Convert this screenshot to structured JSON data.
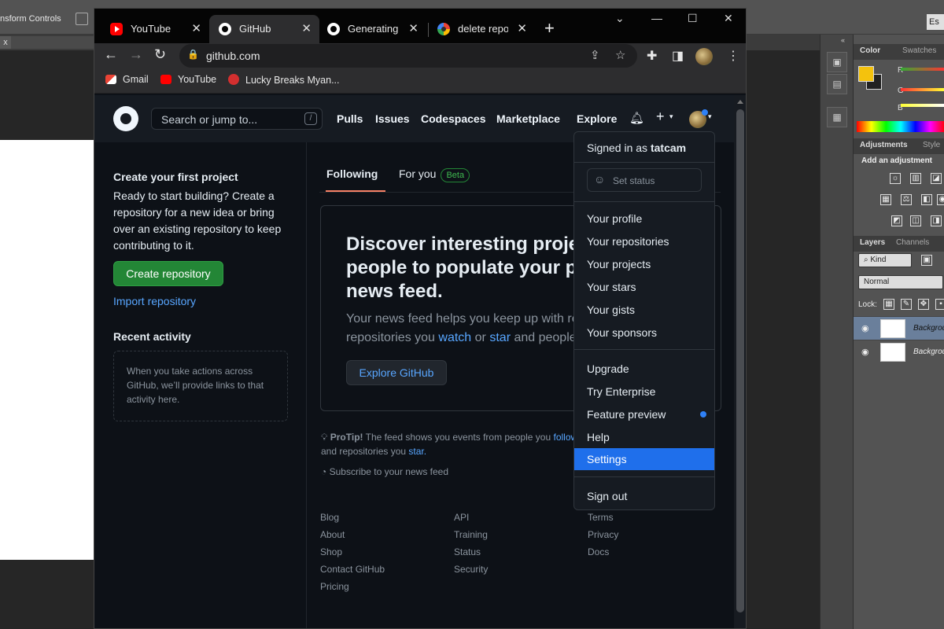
{
  "photoshop": {
    "options_label": "nsform Controls",
    "tab_close": "x",
    "esc_label": "Es",
    "panels": {
      "color_tab": "Color",
      "swatches_tab": "Swatches",
      "slider_r": "R",
      "slider_g": "G",
      "slider_b": "B",
      "adjustments_tab": "Adjustments",
      "styles_tab": "Style",
      "add_adjustment": "Add an adjustment",
      "layers_tab": "Layers",
      "channels_tab": "Channels",
      "kind_filter": "Kind",
      "blend_mode": "Normal",
      "lock_label": "Lock:",
      "layers": [
        {
          "name": "Backgrou"
        },
        {
          "name": "Backgrou"
        }
      ]
    },
    "colors": {
      "foreground": "#f4c20d",
      "background": "#222222"
    }
  },
  "browser": {
    "tabs": [
      {
        "label": "YouTube",
        "icon": "youtube-icon"
      },
      {
        "label": "GitHub",
        "icon": "github-icon"
      },
      {
        "label": "Generating a",
        "icon": "github-icon"
      },
      {
        "label": "delete repo gi",
        "icon": "google-icon"
      }
    ],
    "new_tab": "+",
    "window_controls": {
      "dropdown": "⌄",
      "minimize": "—",
      "maximize": "☐",
      "close": "✕"
    },
    "address": "github.com",
    "bookmarks": [
      {
        "label": "Gmail"
      },
      {
        "label": "YouTube"
      },
      {
        "label": "Lucky Breaks Myan..."
      }
    ]
  },
  "github": {
    "search_placeholder": "Search or jump to...",
    "search_key": "/",
    "nav": [
      "Pulls",
      "Issues",
      "Codespaces",
      "Marketplace",
      "Explore"
    ],
    "sidebar": {
      "first_project_title": "Create your first project",
      "first_project_text": "Ready to start building? Create a repository for a new idea or bring over an existing repository to keep contributing to it.",
      "create_button": "Create repository",
      "import_link": "Import repository",
      "recent_title": "Recent activity",
      "recent_text": "When you take actions across GitHub, we’ll provide links to that activity here."
    },
    "feed_tabs": {
      "following": "Following",
      "for_you": "For you",
      "beta": "Beta"
    },
    "card": {
      "title": "Discover interesting projects and people to populate your personal news feed.",
      "text_prefix": "Your news feed helps you keep up with recent activity on repositories you",
      "watch": "watch",
      "or": "or",
      "star": "star",
      "text_suffix": "and people you follow.",
      "button": "Explore GitHub"
    },
    "protip": {
      "label": "ProTip!",
      "text": "The feed shows you events from people you",
      "follow": "follow",
      "and": "and repositories you",
      "star": "star."
    },
    "subscribe": "Subscribe to your news feed",
    "footer": {
      "col1": [
        "Blog",
        "About",
        "Shop",
        "Contact GitHub",
        "Pricing"
      ],
      "col2": [
        "API",
        "Training",
        "Status",
        "Security"
      ],
      "col3": [
        "Terms",
        "Privacy",
        "Docs"
      ]
    },
    "dropdown": {
      "signed_in_prefix": "Signed in as",
      "username": "tatcam",
      "set_status": "Set status",
      "group1": [
        "Your profile",
        "Your repositories",
        "Your projects",
        "Your stars",
        "Your gists",
        "Your sponsors"
      ],
      "group2": [
        "Upgrade",
        "Try Enterprise",
        "Feature preview",
        "Help",
        "Settings"
      ],
      "sign_out": "Sign out",
      "highlighted": "Settings"
    },
    "colors": {
      "accent_blue": "#58a6ff",
      "green": "#238636",
      "tab_underline": "#f78166",
      "highlight": "#1f6feb"
    }
  }
}
